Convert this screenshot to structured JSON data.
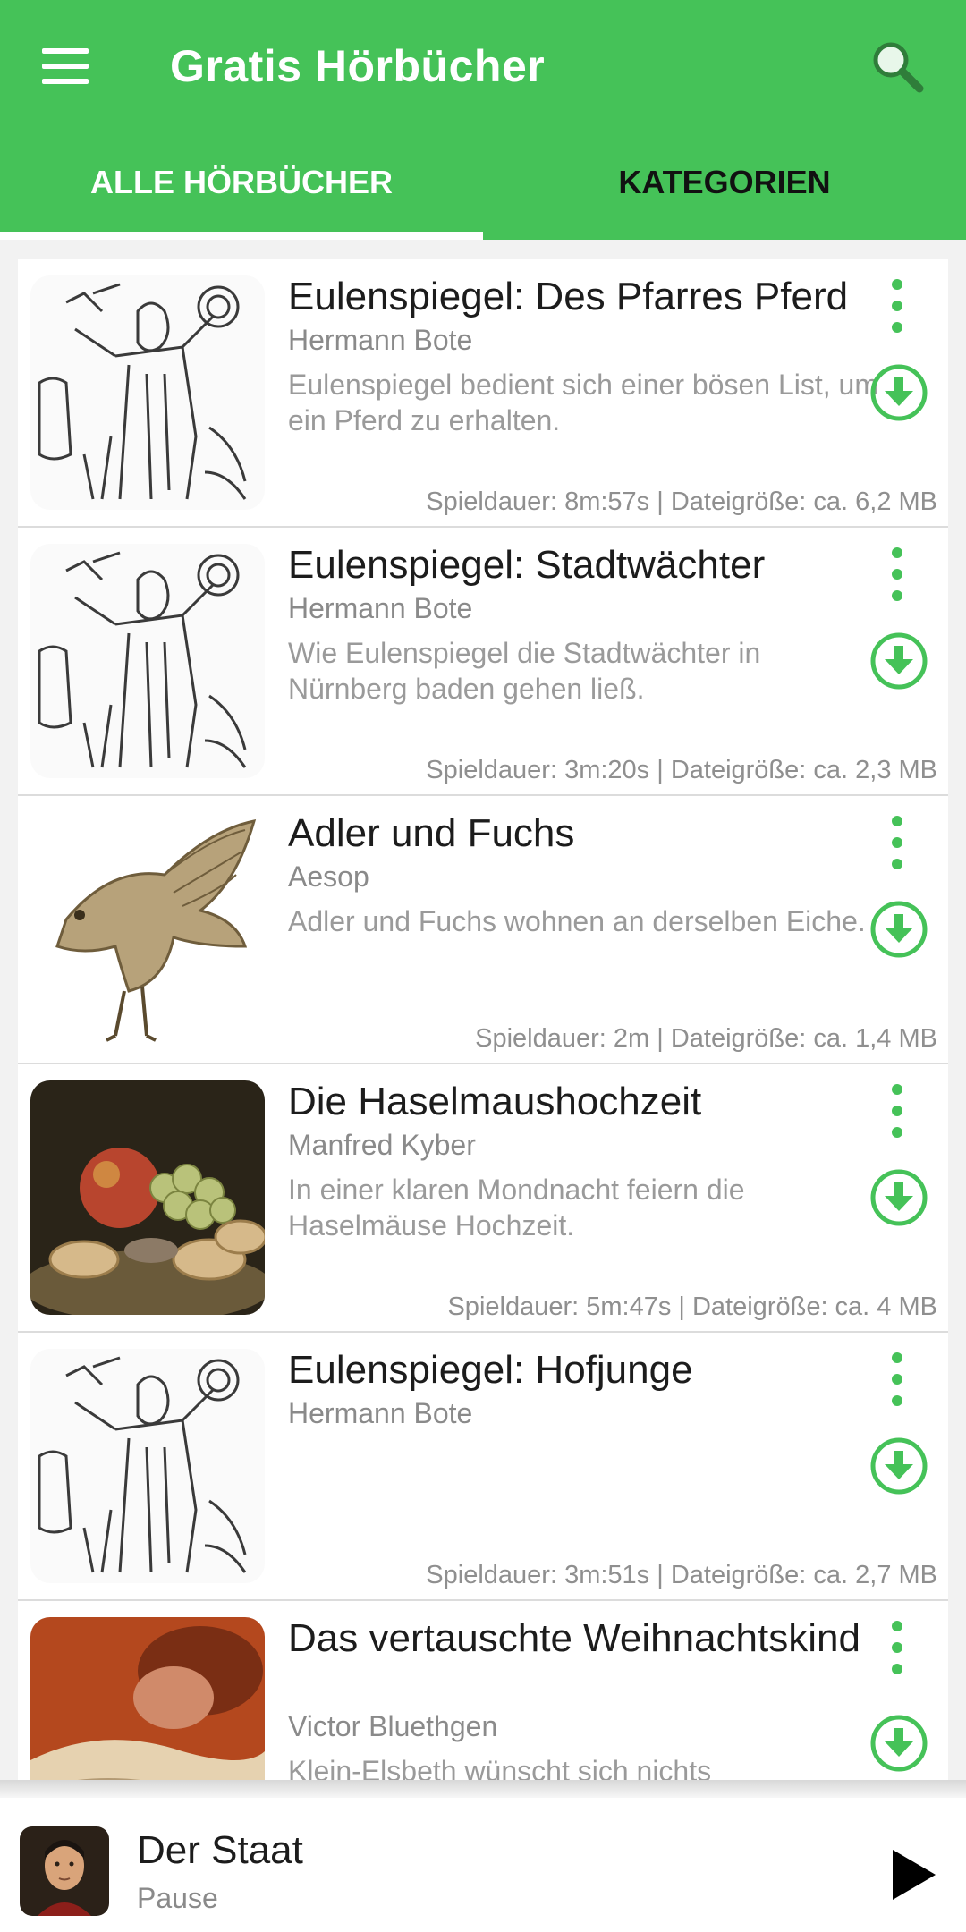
{
  "appbar": {
    "title": "Gratis Hörbücher",
    "menu_icon": "menu-icon",
    "search_icon": "search-icon",
    "color": "#45c258"
  },
  "tabs": [
    {
      "label": "ALLE HÖRBÜCHER",
      "active": true
    },
    {
      "label": "KATEGORIEN",
      "active": false
    }
  ],
  "books": [
    {
      "title": "Eulenspiegel: Des Pfarres Pferd",
      "author": "Hermann Bote",
      "description": "Eulenspiegel bedient sich einer bösen List, um ein Pferd zu erhalten.",
      "meta": "Spieldauer: 8m:57s | Dateigröße: ca. 6,2 MB",
      "cover": "woodcut-eulenspiegel"
    },
    {
      "title": "Eulenspiegel: Stadtwächter",
      "author": "Hermann Bote",
      "description": "Wie Eulenspiegel die Stadtwächter in Nürnberg baden gehen ließ.",
      "meta": "Spieldauer: 3m:20s | Dateigröße: ca. 2,3 MB",
      "cover": "woodcut-eulenspiegel"
    },
    {
      "title": "Adler und Fuchs",
      "author": "Aesop",
      "description": "Adler und Fuchs wohnen an derselben Eiche.",
      "meta": "Spieldauer: 2m | Dateigröße: ca. 1,4 MB",
      "cover": "eagle"
    },
    {
      "title": "Die Haselmaushochzeit",
      "author": "Manfred Kyber",
      "description": "In einer klaren Mondnacht feiern die Haselmäuse Hochzeit.",
      "meta": "Spieldauer: 5m:47s | Dateigröße: ca. 4 MB",
      "cover": "still-life-fruit"
    },
    {
      "title": "Eulenspiegel: Hofjunge",
      "author": "Hermann Bote",
      "description": "",
      "meta": "Spieldauer: 3m:51s | Dateigröße: ca. 2,7 MB",
      "cover": "woodcut-eulenspiegel"
    },
    {
      "title": "Das vertauschte Weihnachtskind",
      "author": "Victor Bluethgen",
      "description": "Klein-Elsbeth wünscht sich nichts",
      "meta": "",
      "cover": "painting-sleeping-child"
    }
  ],
  "item_icons": {
    "more": "more-vert-icon",
    "download": "download-circle-icon",
    "color": "#45c258"
  },
  "player": {
    "title": "Der Staat",
    "status": "Pause",
    "play_icon": "play-icon"
  }
}
